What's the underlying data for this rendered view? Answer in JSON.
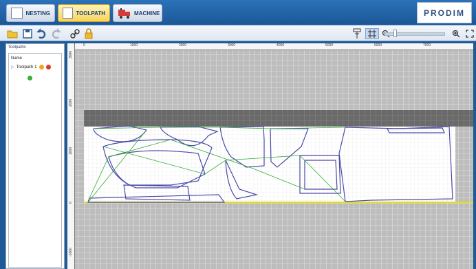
{
  "tabs": [
    {
      "label": "NESTING"
    },
    {
      "label": "TOOLPATH"
    },
    {
      "label": "MACHINE"
    }
  ],
  "brand": "PRODIM",
  "toolbar": {
    "left_icons": [
      "open-folder-icon",
      "save-icon",
      "undo-icon",
      "redo-icon",
      "link-icon",
      "lock-icon"
    ],
    "right_icons": [
      "pin-icon",
      "grid-icon",
      "zoom-out-icon",
      "zoom-in-icon",
      "fit-icon"
    ]
  },
  "panel": {
    "title": "Toolpaths",
    "column": "Name",
    "item": "Toolpath 1"
  },
  "ruler": {
    "x_labels": [
      "0",
      "1000",
      "2000",
      "3000",
      "4000",
      "5000",
      "6000",
      "7000"
    ],
    "y_labels": [
      "3000",
      "2000",
      "1000",
      "0",
      "-1000"
    ]
  }
}
